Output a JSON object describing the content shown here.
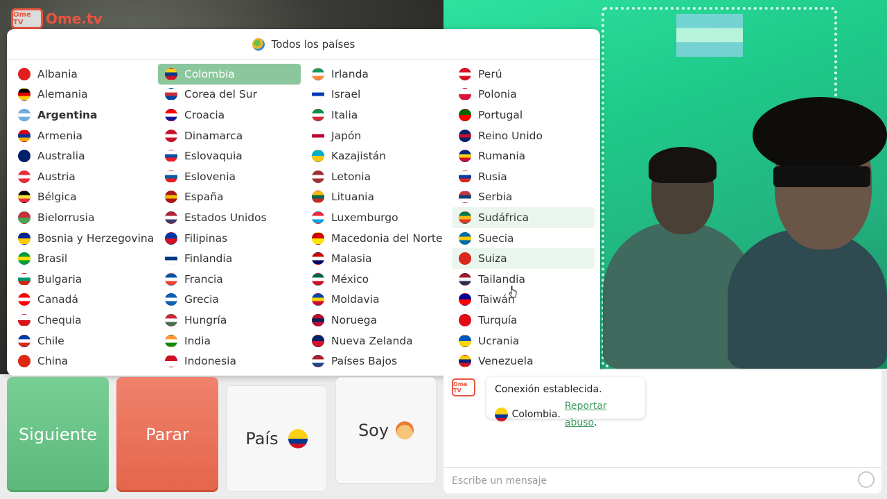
{
  "brand": {
    "logo_small": "Ome TV",
    "logo_text": "Ome.tv"
  },
  "country_panel": {
    "title": "Todos los países",
    "countries": [
      {
        "name": "Albania",
        "colors": [
          "#e41e20",
          "#e41e20"
        ]
      },
      {
        "name": "Alemania",
        "colors": [
          "#000000",
          "#dd0000",
          "#ffce00"
        ]
      },
      {
        "name": "Argentina",
        "colors": [
          "#74acdf",
          "#ffffff",
          "#74acdf"
        ],
        "bold": true
      },
      {
        "name": "Armenia",
        "colors": [
          "#d90012",
          "#0033a0",
          "#f2a800"
        ]
      },
      {
        "name": "Australia",
        "colors": [
          "#012169",
          "#012169"
        ]
      },
      {
        "name": "Austria",
        "colors": [
          "#ed2939",
          "#ffffff",
          "#ed2939"
        ]
      },
      {
        "name": "Bélgica",
        "colors": [
          "#000000",
          "#fae042",
          "#ed2939"
        ]
      },
      {
        "name": "Bielorrusia",
        "colors": [
          "#c8313e",
          "#4aa657"
        ]
      },
      {
        "name": "Bosnia y Herzegovina",
        "colors": [
          "#002395",
          "#fecb00"
        ]
      },
      {
        "name": "Brasil",
        "colors": [
          "#009c3b",
          "#ffdf00",
          "#009c3b"
        ]
      },
      {
        "name": "Bulgaria",
        "colors": [
          "#ffffff",
          "#00966e",
          "#d62612"
        ]
      },
      {
        "name": "Canadá",
        "colors": [
          "#ff0000",
          "#ffffff",
          "#ff0000"
        ]
      },
      {
        "name": "Chequia",
        "colors": [
          "#ffffff",
          "#d7141a"
        ]
      },
      {
        "name": "Chile",
        "colors": [
          "#0039a6",
          "#ffffff",
          "#d52b1e"
        ]
      },
      {
        "name": "China",
        "colors": [
          "#de2910",
          "#de2910"
        ]
      },
      {
        "name": "Colombia",
        "colors": [
          "#fcd116",
          "#003893",
          "#ce1126"
        ],
        "selected": true
      },
      {
        "name": "Corea del Sur",
        "colors": [
          "#ffffff",
          "#cd2e3a",
          "#0047a0"
        ]
      },
      {
        "name": "Croacia",
        "colors": [
          "#ff0000",
          "#ffffff",
          "#171796"
        ]
      },
      {
        "name": "Dinamarca",
        "colors": [
          "#c8102e",
          "#ffffff",
          "#c8102e"
        ]
      },
      {
        "name": "Eslovaquia",
        "colors": [
          "#ffffff",
          "#0b4ea2",
          "#ee1c25"
        ]
      },
      {
        "name": "Eslovenia",
        "colors": [
          "#ffffff",
          "#005da4",
          "#ed1c24"
        ]
      },
      {
        "name": "España",
        "colors": [
          "#aa151b",
          "#f1bf00",
          "#aa151b"
        ]
      },
      {
        "name": "Estados Unidos",
        "colors": [
          "#b22234",
          "#ffffff",
          "#3c3b6e"
        ]
      },
      {
        "name": "Filipinas",
        "colors": [
          "#0038a8",
          "#ce1126"
        ]
      },
      {
        "name": "Finlandia",
        "colors": [
          "#ffffff",
          "#003580",
          "#ffffff"
        ]
      },
      {
        "name": "Francia",
        "colors": [
          "#0055a4",
          "#ffffff",
          "#ef4135"
        ]
      },
      {
        "name": "Grecia",
        "colors": [
          "#0d5eaf",
          "#ffffff",
          "#0d5eaf"
        ]
      },
      {
        "name": "Hungría",
        "colors": [
          "#ce2939",
          "#ffffff",
          "#477050"
        ]
      },
      {
        "name": "India",
        "colors": [
          "#ff9933",
          "#ffffff",
          "#138808"
        ]
      },
      {
        "name": "Indonesia",
        "colors": [
          "#ce1126",
          "#ffffff"
        ]
      },
      {
        "name": "Irlanda",
        "colors": [
          "#169b62",
          "#ffffff",
          "#ff883e"
        ]
      },
      {
        "name": "Israel",
        "colors": [
          "#ffffff",
          "#0038b8",
          "#ffffff"
        ]
      },
      {
        "name": "Italia",
        "colors": [
          "#009246",
          "#ffffff",
          "#ce2b37"
        ]
      },
      {
        "name": "Japón",
        "colors": [
          "#ffffff",
          "#bc002d",
          "#ffffff"
        ]
      },
      {
        "name": "Kazajistán",
        "colors": [
          "#00afca",
          "#fec50c"
        ]
      },
      {
        "name": "Letonia",
        "colors": [
          "#9e3039",
          "#ffffff",
          "#9e3039"
        ]
      },
      {
        "name": "Lituania",
        "colors": [
          "#fdb913",
          "#006a44",
          "#c1272d"
        ]
      },
      {
        "name": "Luxemburgo",
        "colors": [
          "#ed2939",
          "#ffffff",
          "#00a1de"
        ]
      },
      {
        "name": "Macedonia del Norte",
        "colors": [
          "#d20000",
          "#ffe600"
        ]
      },
      {
        "name": "Malasia",
        "colors": [
          "#cc0001",
          "#ffffff",
          "#010066"
        ]
      },
      {
        "name": "México",
        "colors": [
          "#006847",
          "#ffffff",
          "#ce1126"
        ]
      },
      {
        "name": "Moldavia",
        "colors": [
          "#0046ae",
          "#ffd200",
          "#cc092f"
        ]
      },
      {
        "name": "Noruega",
        "colors": [
          "#ba0c2f",
          "#00205b",
          "#ba0c2f"
        ]
      },
      {
        "name": "Nueva Zelanda",
        "colors": [
          "#012169",
          "#cc142b"
        ]
      },
      {
        "name": "Países Bajos",
        "colors": [
          "#ae1c28",
          "#ffffff",
          "#21468b"
        ]
      },
      {
        "name": "Perú",
        "colors": [
          "#d91023",
          "#ffffff",
          "#d91023"
        ]
      },
      {
        "name": "Polonia",
        "colors": [
          "#ffffff",
          "#dc143c"
        ]
      },
      {
        "name": "Portugal",
        "colors": [
          "#006600",
          "#ff0000"
        ]
      },
      {
        "name": "Reino Unido",
        "colors": [
          "#012169",
          "#c8102e",
          "#012169"
        ]
      },
      {
        "name": "Rumania",
        "colors": [
          "#002b7f",
          "#fcd116",
          "#ce1126"
        ]
      },
      {
        "name": "Rusia",
        "colors": [
          "#ffffff",
          "#0039a6",
          "#d52b1e"
        ]
      },
      {
        "name": "Serbia",
        "colors": [
          "#c6363c",
          "#0c4076",
          "#ffffff"
        ]
      },
      {
        "name": "Sudáfrica",
        "colors": [
          "#007a4d",
          "#ffb612",
          "#de3831"
        ],
        "hover": true
      },
      {
        "name": "Suecia",
        "colors": [
          "#006aa7",
          "#fecc00",
          "#006aa7"
        ]
      },
      {
        "name": "Suiza",
        "colors": [
          "#da291c",
          "#da291c"
        ],
        "hover": true
      },
      {
        "name": "Tailandia",
        "colors": [
          "#a51931",
          "#f4f5f8",
          "#2d2a4a"
        ]
      },
      {
        "name": "Taiwán",
        "colors": [
          "#000095",
          "#fe0000"
        ]
      },
      {
        "name": "Turquía",
        "colors": [
          "#e30a17",
          "#e30a17"
        ]
      },
      {
        "name": "Ucrania",
        "colors": [
          "#0057b7",
          "#ffd700"
        ]
      },
      {
        "name": "Venezuela",
        "colors": [
          "#ffcc00",
          "#00247d",
          "#cf142b"
        ]
      }
    ]
  },
  "controls": {
    "next_label": "Siguiente",
    "stop_label": "Parar",
    "country_label": "País",
    "gender_label": "Soy"
  },
  "chat": {
    "logo_small": "Ome TV",
    "connection_text": "Conexión establecida.",
    "country_text": "Colombia.",
    "report_link": "Reportar abuso",
    "report_suffix": ".",
    "message_placeholder": "Escribe un mensaje"
  },
  "colors": {
    "next_green": "#66c184",
    "stop_red": "#e86c52",
    "selected_row": "#8cc69d",
    "link_green": "#3f9a5f",
    "brand_red": "#e8553f"
  }
}
